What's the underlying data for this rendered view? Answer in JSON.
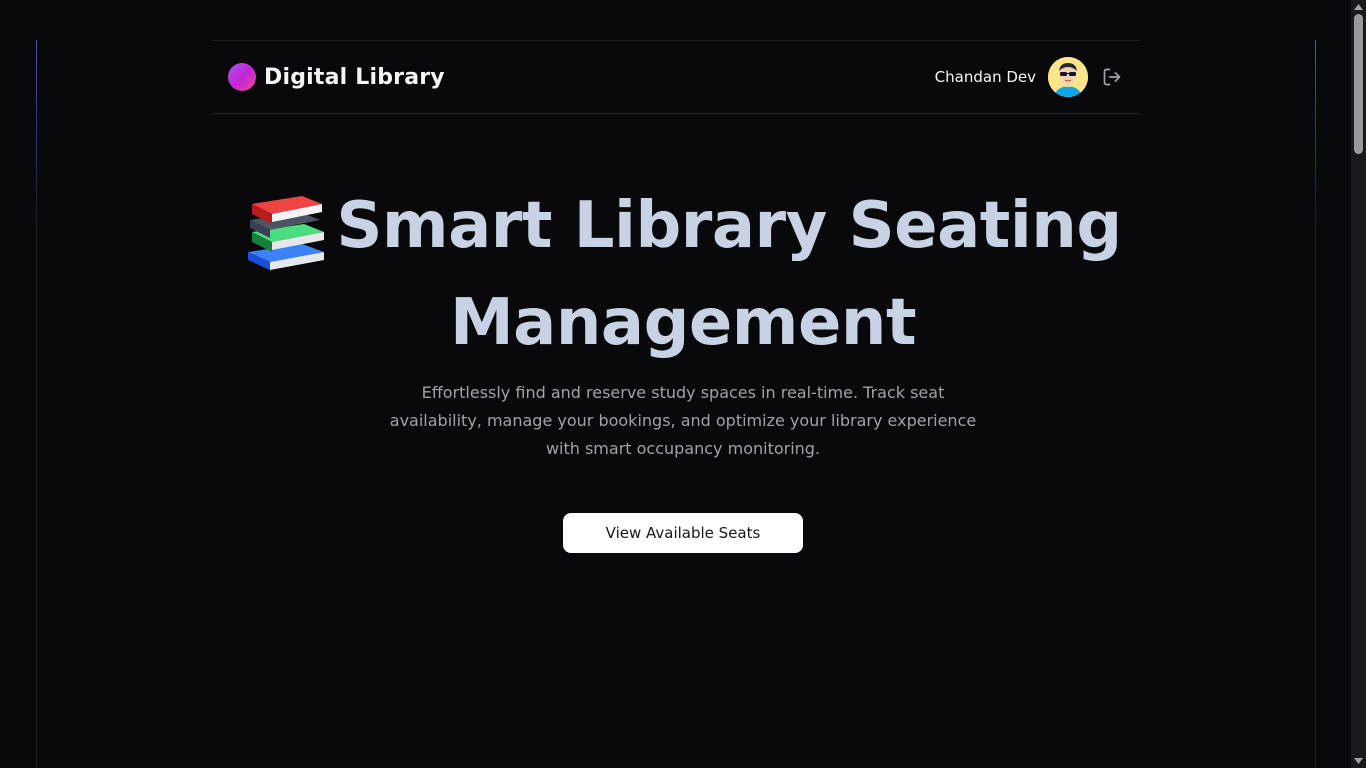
{
  "navbar": {
    "brand_name": "Digital Library",
    "user_name": "Chandan Dev",
    "logo_gradient": [
      "#a855f7",
      "#ec4899"
    ],
    "avatar_icon": "avatar-icon",
    "logout_icon": "logout-icon"
  },
  "hero": {
    "title_line1": "Smart Library Seating",
    "title_line2": "Management",
    "title_icon": "books-emoji-icon",
    "description": "Effortlessly find and reserve study spaces in real-time. Track seat availability, manage your bookings, and optimize your library experience with smart occupancy monitoring.",
    "cta_label": "View Available Seats"
  },
  "colors": {
    "background": "#09090b",
    "title": "#c7d2e4",
    "text_muted": "#a1a1aa",
    "cta_bg": "#ffffff",
    "cta_text": "#18181b"
  }
}
